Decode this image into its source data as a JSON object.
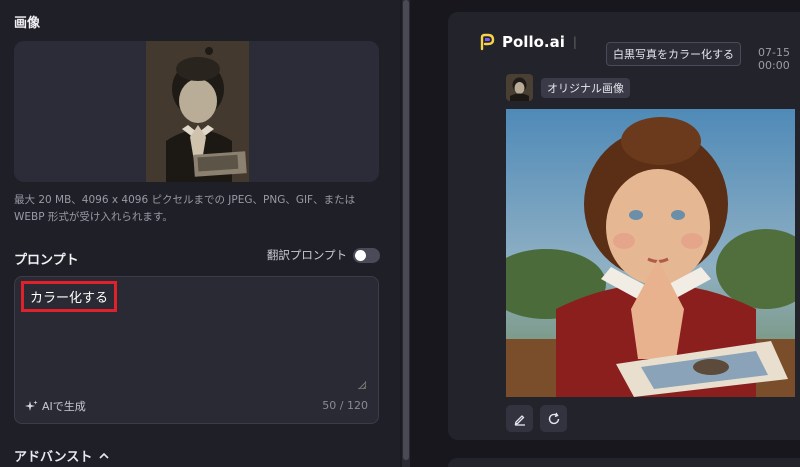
{
  "left": {
    "image_section_title": "画像",
    "upload_hint": "最大 20 MB、4096 x 4096 ピクセルまでの JPEG、PNG、GIF、または WEBP 形式が受け入れられます。",
    "prompt_title": "プロンプト",
    "translate_label": "翻訳プロンプト",
    "translate_enabled": false,
    "prompt_value": "カラー化する",
    "ai_generate_label": "AIで生成",
    "char_counter": "50 / 120",
    "advanced_label": "アドバンスト"
  },
  "right": {
    "brand_name": "Pollo.ai",
    "task_pill": "白黒写真をカラー化する",
    "timestamp": "07-15 00:00",
    "original_label": "オリジナル画像"
  },
  "colors": {
    "highlight": "#e0202a",
    "background": "#1b1b22",
    "card": "#23232b"
  },
  "icons": [
    "sparkle-icon",
    "chevron-up-icon",
    "edit-icon",
    "refresh-icon",
    "pollo-logo-icon"
  ]
}
